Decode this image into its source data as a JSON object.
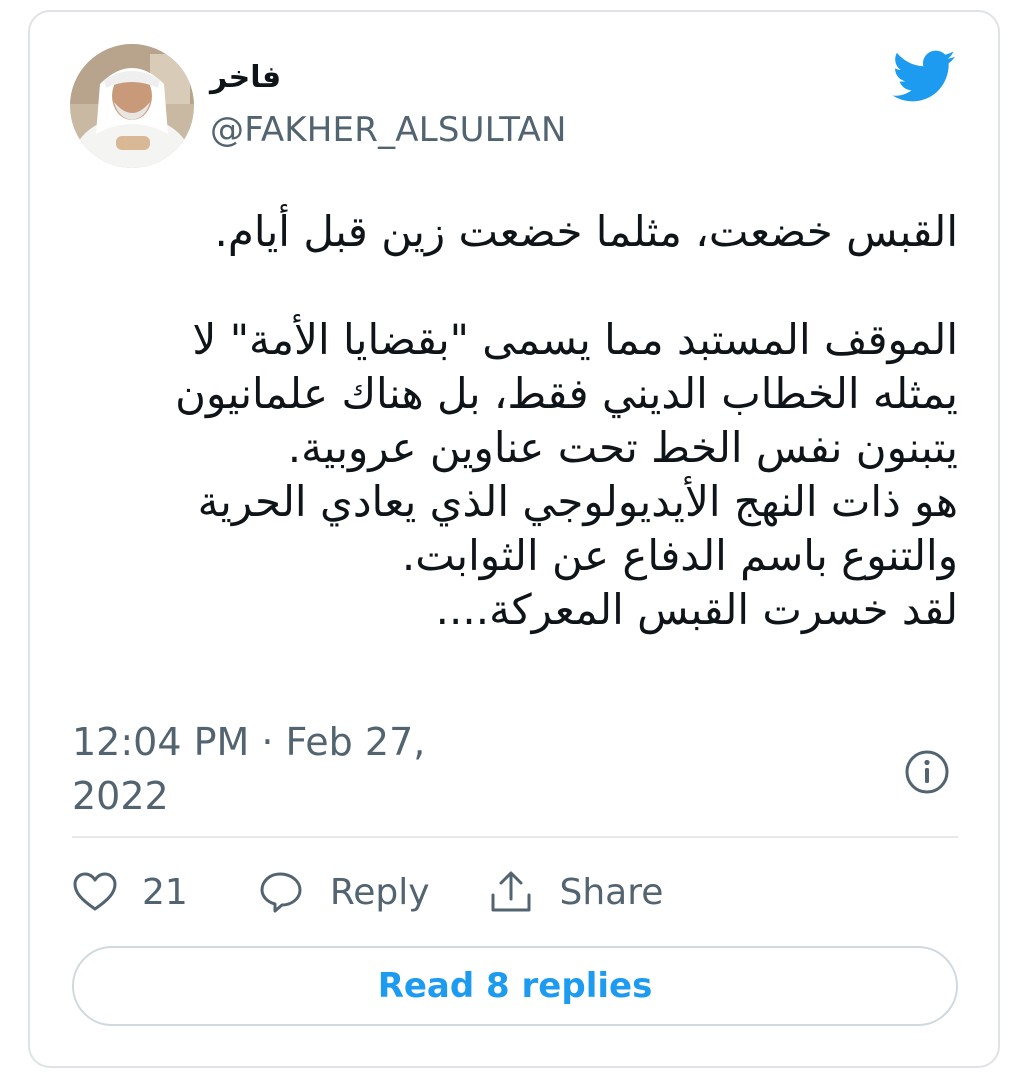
{
  "tweet": {
    "author": {
      "display_name": "فاخر",
      "handle": "@FAKHER_ALSULTAN",
      "avatar_icon": "profile-photo"
    },
    "logo_icon": "twitter-bird-icon",
    "brand_color": "#1d9bf0",
    "text_lines": [
      "القبس خضعت، مثلما خضعت زين قبل أيام.",
      "",
      "الموقف المستبد مما يسمى \"بقضايا الأمة\" لا",
      "يمثله الخطاب الديني فقط، بل هناك علمانيون",
      "يتبنون نفس الخط تحت عناوين عروبية.",
      "هو ذات النهج الأيديولوجي الذي يعادي الحرية",
      "والتنوع باسم الدفاع عن الثوابت.",
      "لقد خسرت القبس المعركة...."
    ],
    "timestamp_line1": "12:04 PM · Feb 27,",
    "timestamp_line2": "2022",
    "actions": {
      "like_count": "21",
      "reply_label": "Reply",
      "share_label": "Share"
    },
    "read_replies_label": "Read 8 replies"
  }
}
